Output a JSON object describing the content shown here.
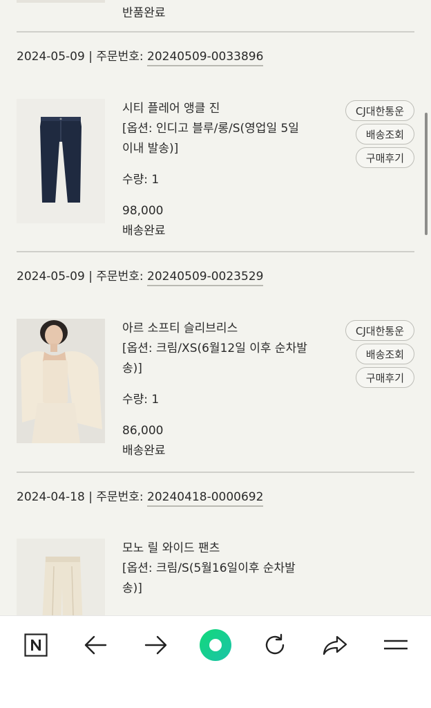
{
  "top_item": {
    "status": "반품완료"
  },
  "orders": [
    {
      "date": "2024-05-09",
      "separator": " | ",
      "order_label": "주문번호: ",
      "order_number": "20240509-0033896",
      "product": {
        "name": "시티 플레어 앵클 진",
        "option": "[옵션: 인디고 블루/롱/S(영업일 5일 이내 발송)]",
        "quantity": "수량: 1",
        "price": "98,000",
        "status": "배송완료",
        "image": "jeans-photo"
      },
      "buttons": [
        "CJ대한통운",
        "배송조회",
        "구매후기"
      ]
    },
    {
      "date": "2024-05-09",
      "separator": " | ",
      "order_label": "주문번호: ",
      "order_number": "20240509-0023529",
      "product": {
        "name": "아르 소프티 슬리브리스",
        "option": "[옵션: 크림/XS(6월12일 이후 순차발송)]",
        "quantity": "수량: 1",
        "price": "86,000",
        "status": "배송완료",
        "image": "sleeveless-top-photo"
      },
      "buttons": [
        "CJ대한통운",
        "배송조회",
        "구매후기"
      ]
    },
    {
      "date": "2024-04-18",
      "separator": " | ",
      "order_label": "주문번호: ",
      "order_number": "20240418-0000692",
      "product": {
        "name": "모노 릴 와이드 팬츠",
        "option": "[옵션: 크림/S(5월16일이후 순차발송)]",
        "image": "wide-pants-photo"
      }
    }
  ],
  "bottom_nav": {
    "items": [
      "naver-home-icon",
      "back-arrow-icon",
      "forward-arrow-icon",
      "green-dot-icon",
      "refresh-icon",
      "share-icon",
      "menu-icon"
    ],
    "accent": "#19cc7e"
  }
}
